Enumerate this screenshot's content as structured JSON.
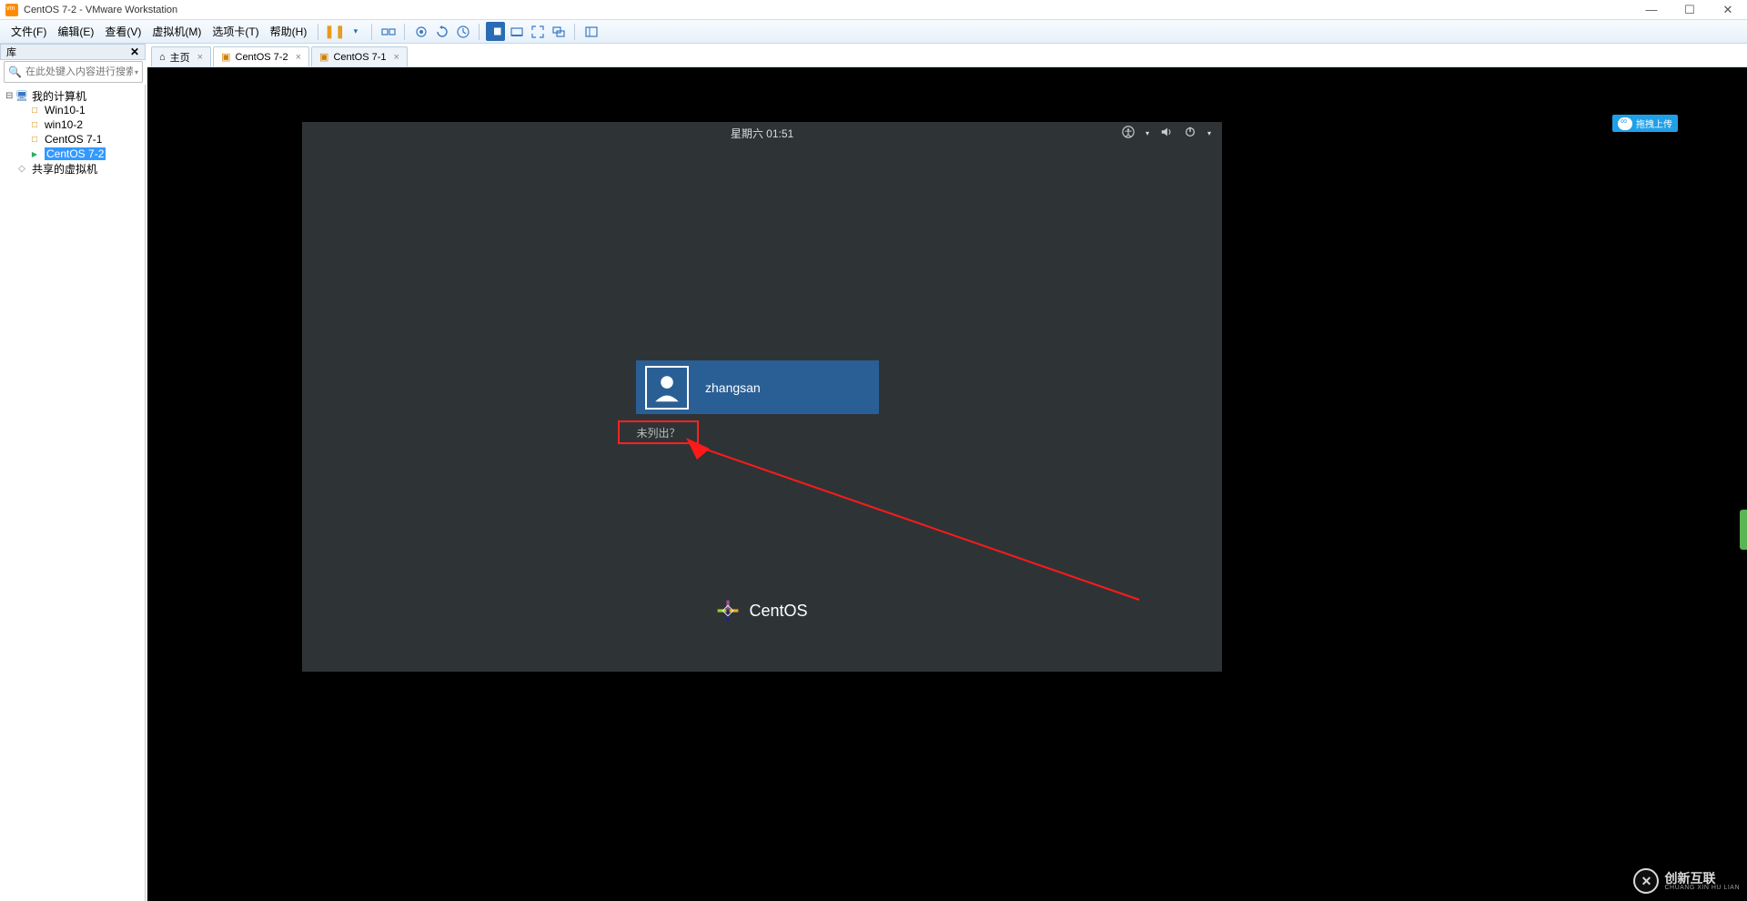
{
  "window": {
    "title": "CentOS 7-2 - VMware Workstation"
  },
  "menubar": {
    "items": [
      "文件(F)",
      "编辑(E)",
      "查看(V)",
      "虚拟机(M)",
      "选项卡(T)",
      "帮助(H)"
    ]
  },
  "sidebar": {
    "header": "库",
    "search_placeholder": "在此处键入内容进行搜索",
    "root": "我的计算机",
    "vms": [
      "Win10-1",
      "win10-2",
      "CentOS 7-1",
      "CentOS 7-2"
    ],
    "shared": "共享的虚拟机"
  },
  "tabs": [
    {
      "label": "主页",
      "icon": "home"
    },
    {
      "label": "CentOS 7-2",
      "icon": "vm",
      "active": true
    },
    {
      "label": "CentOS 7-1",
      "icon": "vm"
    }
  ],
  "guest": {
    "clock": "星期六 01:51",
    "user": "zhangsan",
    "not_listed": "未列出？",
    "brand": "CentOS"
  },
  "badge": {
    "upload": "拖拽上传"
  },
  "watermark": {
    "text": "创新互联",
    "sub": "CHUANG XIN HU LIAN"
  }
}
